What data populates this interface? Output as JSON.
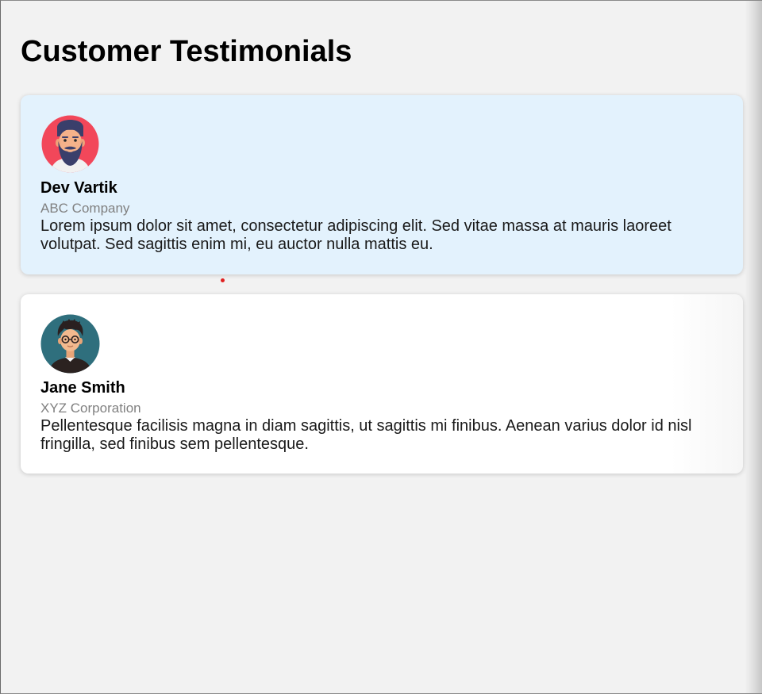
{
  "page": {
    "title": "Customer Testimonials"
  },
  "testimonials": [
    {
      "name": "Dev Vartik",
      "company": "ABC Company",
      "quote": "Lorem ipsum dolor sit amet, consectetur adipiscing elit. Sed vitae massa at mauris laoreet volutpat. Sed sagittis enim mi, eu auctor nulla mattis eu.",
      "avatar_icon": "bearded-man-avatar-icon",
      "background": "#e3f2fd",
      "avatar_bg": "#f2475a"
    },
    {
      "name": "Jane Smith",
      "company": "XYZ Corporation",
      "quote": "Pellentesque facilisis magna in diam sagittis, ut sagittis mi finibus. Aenean varius dolor id nisl fringilla, sed finibus sem pellentesque.",
      "avatar_icon": "glasses-person-avatar-icon",
      "background": "#ffffff",
      "avatar_bg": "#2f6f7d"
    }
  ],
  "colors": {
    "page_background": "#f2f2f2",
    "company_text": "#808080",
    "indicator_dot": "#e02020"
  }
}
